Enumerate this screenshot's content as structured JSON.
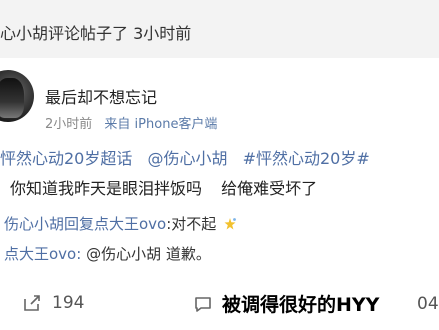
{
  "notification": {
    "text": "心小胡评论帖子了 3小时前"
  },
  "post": {
    "username": "最后却不想忘记",
    "time": "2小时前",
    "source": "来自 iPhone客户端",
    "tags": [
      "怦然心动20岁超话",
      "@伤心小胡",
      "#怦然心动20岁#"
    ],
    "content": [
      "你知道我昨天是眼泪拌饭吗",
      "给俺难受坏了"
    ]
  },
  "comments": [
    {
      "name": "伤心小胡回复点大王ovo",
      "text": ":对不起"
    },
    {
      "name": "点大王ovo:",
      "text": "@伤心小胡 道歉。"
    }
  ],
  "actions": {
    "share_count": "194",
    "cut_count": "04"
  },
  "watermark": {
    "text": "被调得很好的HYY"
  }
}
